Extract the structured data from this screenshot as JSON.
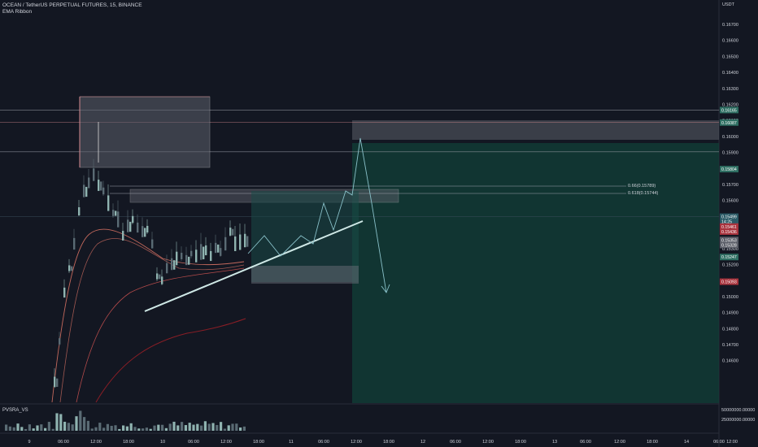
{
  "header": {
    "symbol_line": "OCEAN / TetherUS PERPETUAL FUTURES, 15, BINANCE",
    "indicator": "EMA Ribbon"
  },
  "price_axis": {
    "unit": "USDT",
    "labels": [
      "0.16700",
      "0.16600",
      "0.16500",
      "0.16400",
      "0.16300",
      "0.16200",
      "0.16100",
      "0.16000",
      "0.15900",
      "0.15800",
      "0.15700",
      "0.15600",
      "0.15500",
      "0.15400",
      "0.15300",
      "0.15200",
      "0.15100",
      "0.15000",
      "0.14900",
      "0.14800",
      "0.14700",
      "0.14600"
    ],
    "badges": [
      {
        "text": "0.16165",
        "color": "#2e6e62",
        "value": 0.16165
      },
      {
        "text": "0.16087",
        "color": "#2e6e62",
        "value": 0.16087
      },
      {
        "text": "0.15804",
        "color": "#2e6e62",
        "value": 0.15796
      },
      {
        "text": "0.15499",
        "color": "#2a5a66",
        "value": 0.15499
      },
      {
        "text": "14:25",
        "color": "#2a5a66",
        "value": 0.15468
      },
      {
        "text": "0.15461",
        "color": "#a8333d",
        "value": 0.15437
      },
      {
        "text": "0.15436",
        "color": "#a8333d",
        "value": 0.15406
      },
      {
        "text": "0.15353",
        "color": "#5b5e68",
        "value": 0.15353
      },
      {
        "text": "0.15328",
        "color": "#5b5e68",
        "value": 0.15322
      },
      {
        "text": "0.15247",
        "color": "#2e6e62",
        "value": 0.15247
      },
      {
        "text": "0.15093",
        "color": "#a8333d",
        "value": 0.15093
      }
    ]
  },
  "fib_labels": [
    "0.66(0.15789)",
    "0.618(0.15744)"
  ],
  "volume_pane": {
    "title": "PVSRA_VS",
    "labels": [
      "50000000.00000",
      "25000000.00000"
    ]
  },
  "time_axis": {
    "labels": [
      "9",
      "06:00",
      "12:00",
      "18:00",
      "10",
      "06:00",
      "12:00",
      "18:00",
      "11",
      "06:00",
      "12:00",
      "18:00",
      "12",
      "06:00",
      "12:00",
      "18:00",
      "13",
      "06:00",
      "12:00",
      "18:00",
      "14",
      "06:00",
      "12:00",
      "18:00",
      "06:"
    ]
  },
  "colors": {
    "background": "#131722",
    "axis_text": "#d1d4dc",
    "candle_up": "#8fb3b0",
    "candle_down": "#5a6b74",
    "ema_fast": "#c3685c",
    "ema_slow": "#8a1e26",
    "trend_line": "#cfe8e6",
    "target_zone": "#114038",
    "projection": "#88c0c8"
  }
}
